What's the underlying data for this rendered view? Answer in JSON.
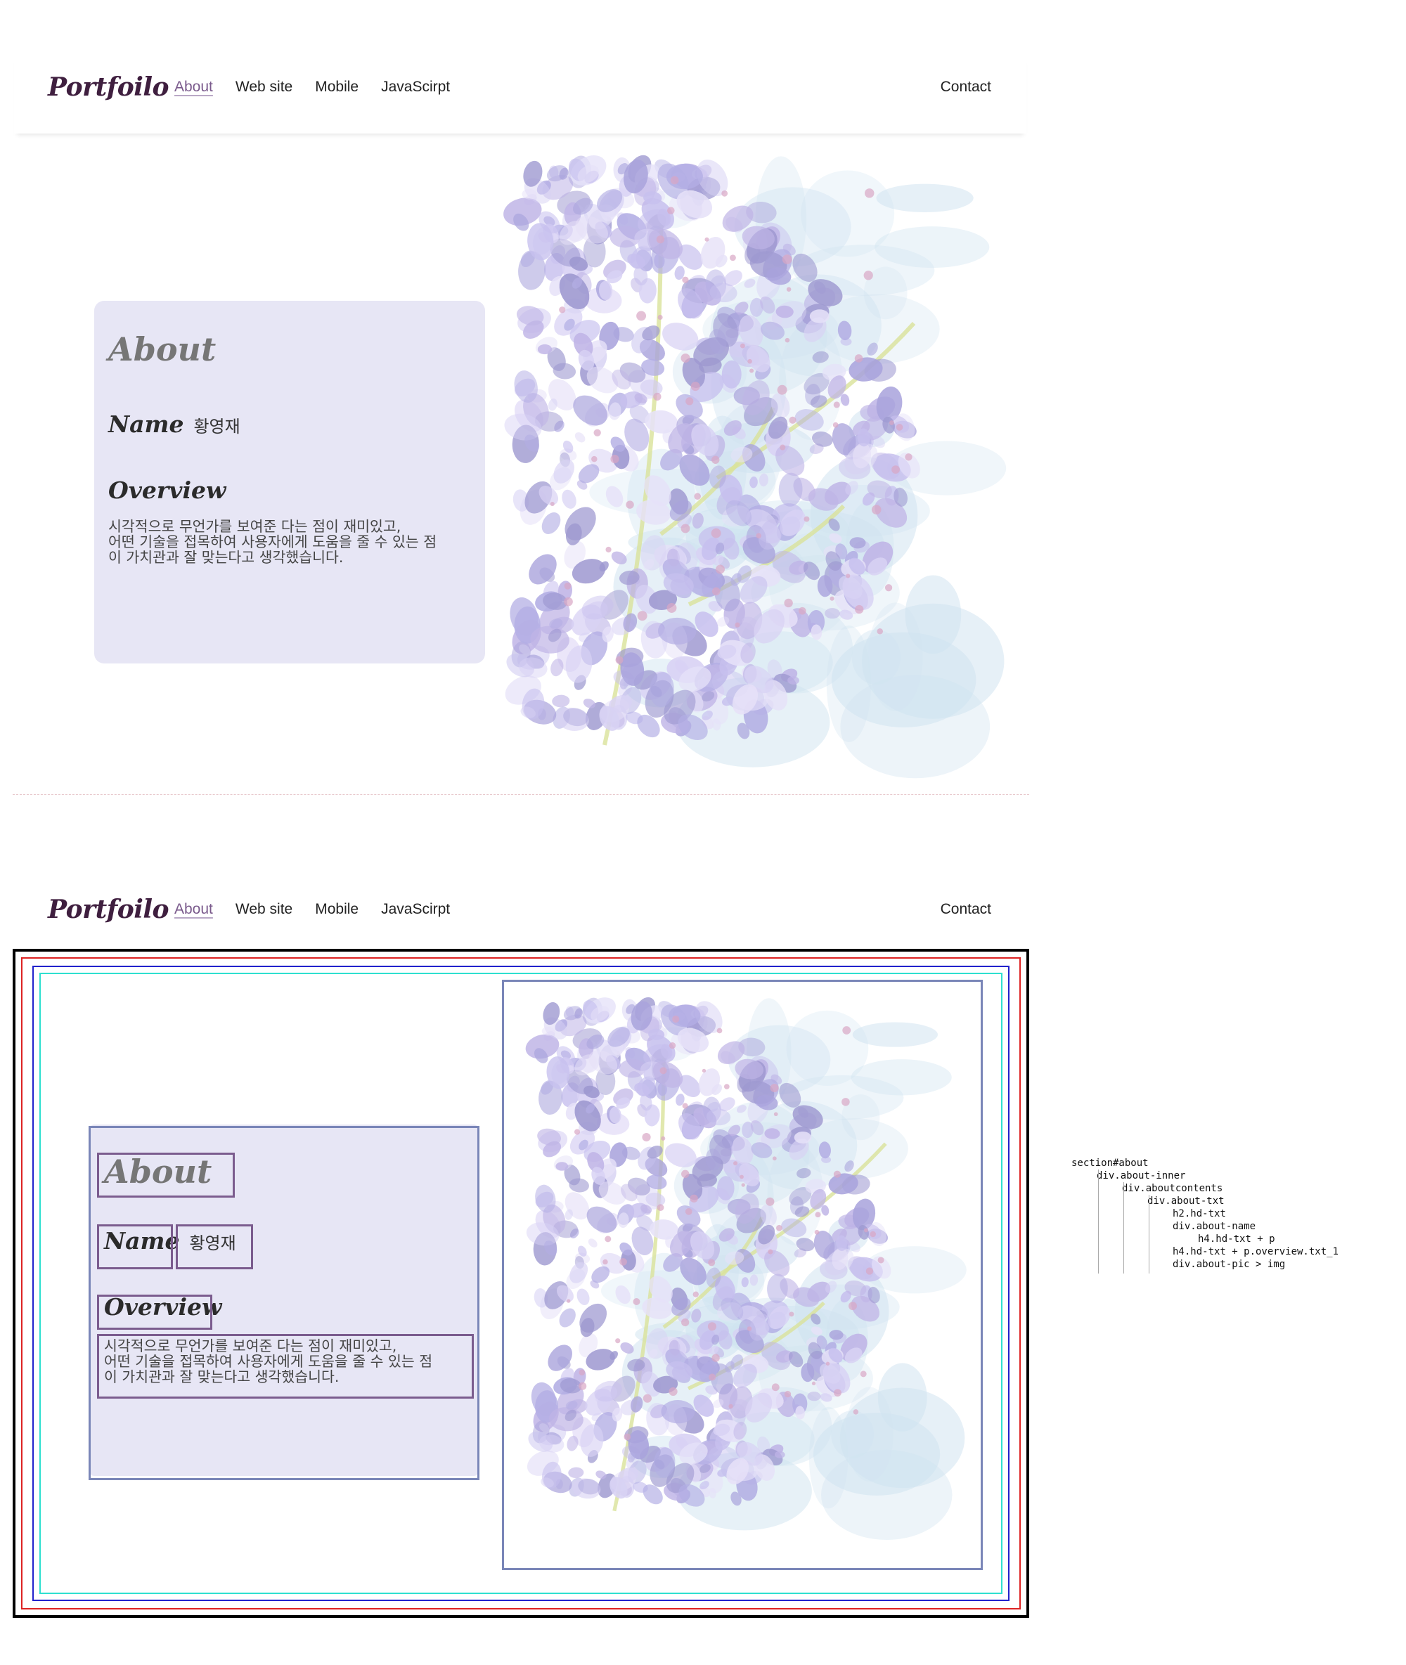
{
  "nav": {
    "logo": "Portfoilo",
    "items": [
      {
        "label": "About",
        "active": true
      },
      {
        "label": "Web site",
        "active": false
      },
      {
        "label": "Mobile",
        "active": false
      },
      {
        "label": "JavaScirpt",
        "active": false
      }
    ],
    "contact": "Contact"
  },
  "about": {
    "heading": "About",
    "name_label": "Name",
    "name_value": "황영재",
    "overview_label": "Overview",
    "overview_lines": [
      "시각적으로 무언가를 보여준 다는 점이 재미있고,",
      "어떤 기술을 접목하여 사용자에게 도움을 줄 수 있는 점",
      "이 가치관과 잘 맞는다고 생각했습니다."
    ]
  },
  "dom_tree": [
    {
      "depth": 0,
      "text": "section#about"
    },
    {
      "depth": 1,
      "text": "div.about-inner"
    },
    {
      "depth": 2,
      "text": "div.aboutcontents"
    },
    {
      "depth": 3,
      "text": "div.about-txt"
    },
    {
      "depth": 4,
      "text": "h2.hd-txt"
    },
    {
      "depth": 4,
      "text": "div.about-name"
    },
    {
      "depth": 5,
      "text": "h4.hd-txt + p"
    },
    {
      "depth": 4,
      "text": "h4.hd-txt + p.overview.txt_1"
    },
    {
      "depth": 4,
      "text": "div.about-pic > img"
    }
  ],
  "colors": {
    "logo": "#3f1f3f",
    "active_link": "#7a5a8c",
    "card_bg": "#e6e4f4",
    "wire_section": "#000000",
    "wire_inner": "#dd2222",
    "wire_contents": "#2222cc",
    "wire_txt": "#2ee0d0",
    "wire_box": "#7a86b8",
    "wire_text_box": "#7b5c8e"
  },
  "icons": {
    "image": "wisteria-flower-illustration"
  }
}
